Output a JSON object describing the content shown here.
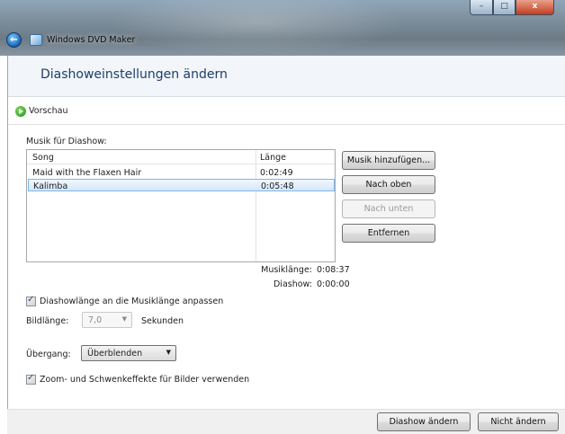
{
  "window": {
    "title": "Windows DVD Maker",
    "minimize": "–",
    "maximize": "□",
    "close": "x",
    "back": "←"
  },
  "page": {
    "heading": "Diashoweinstellungen ändern",
    "preview_label": "Vorschau"
  },
  "music": {
    "label": "Musik für Diashow:",
    "columns": {
      "song": "Song",
      "length": "Länge"
    },
    "rows": [
      {
        "song": "Maid with the Flaxen Hair",
        "length": "0:02:49",
        "selected": false
      },
      {
        "song": "Kalimba",
        "length": "0:05:48",
        "selected": true
      }
    ],
    "buttons": {
      "add": "Musik hinzufügen...",
      "up": "Nach oben",
      "down": "Nach unten",
      "remove": "Entfernen"
    },
    "summary": {
      "music_length_label": "Musiklänge:",
      "music_length_value": "0:08:37",
      "slideshow_label": "Diashow:",
      "slideshow_value": "0:00:00"
    }
  },
  "options": {
    "fit_to_music": {
      "label": "Diashowlänge an die Musiklänge anpassen",
      "checked": true
    },
    "image_length": {
      "label": "Bildlänge:",
      "value": "7,0",
      "unit": "Sekunden"
    },
    "transition": {
      "label": "Übergang:",
      "value": "Überblenden"
    },
    "pan_zoom": {
      "label": "Zoom- und Schwenkeffekte für Bilder verwenden",
      "checked": true
    }
  },
  "footer": {
    "change": "Diashow ändern",
    "cancel": "Nicht ändern"
  }
}
